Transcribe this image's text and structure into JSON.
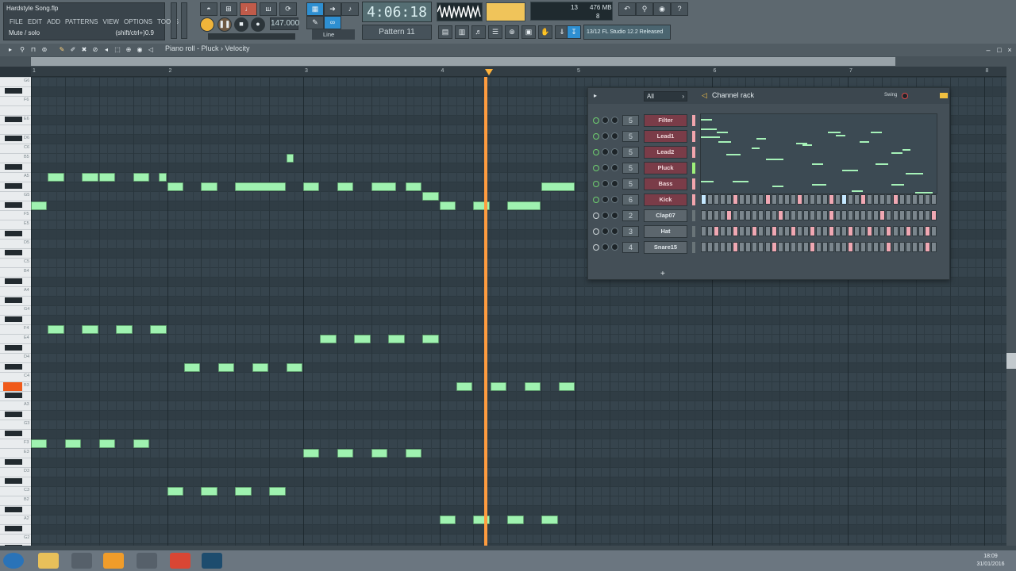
{
  "project": {
    "title": "Hardstyle Song.flp",
    "menus": [
      "FILE",
      "EDIT",
      "ADD",
      "PATTERNS",
      "VIEW",
      "OPTIONS",
      "TOOLS",
      "?"
    ],
    "hint_left": "Mute / solo",
    "hint_right": "(shift/ctrl+)0.9"
  },
  "transport": {
    "time": "4:06:18",
    "tempo": "147.000",
    "pattern": "Pattern 11",
    "snap": "Line",
    "cpu_top": "13",
    "cpu_mem": "476 MB",
    "cpu_bottom": "8",
    "news": "13/12  FL Studio 12.2 Released"
  },
  "piano_roll": {
    "breadcrumb": "Piano roll - Pluck › Velocity",
    "bars": [
      "1",
      "2",
      "3",
      "4",
      "5",
      "6",
      "7",
      "8"
    ],
    "key_labels": [
      {
        "label": "G6",
        "row": 0
      },
      {
        "label": "F6",
        "row": 2
      },
      {
        "label": "E6",
        "row": 4
      },
      {
        "label": "D6",
        "row": 6
      },
      {
        "label": "C6",
        "row": 7
      },
      {
        "label": "B5",
        "row": 8
      },
      {
        "label": "A5",
        "row": 10
      },
      {
        "label": "G5",
        "row": 12
      },
      {
        "label": "F5",
        "row": 14
      },
      {
        "label": "E5",
        "row": 15
      },
      {
        "label": "D5",
        "row": 17
      },
      {
        "label": "C5",
        "row": 19
      },
      {
        "label": "B4",
        "row": 20
      },
      {
        "label": "A4",
        "row": 22
      },
      {
        "label": "G4",
        "row": 24
      },
      {
        "label": "F4",
        "row": 26
      },
      {
        "label": "E4",
        "row": 27
      },
      {
        "label": "D4",
        "row": 29
      },
      {
        "label": "C4",
        "row": 31
      },
      {
        "label": "B3",
        "row": 32
      },
      {
        "label": "A3",
        "row": 34
      },
      {
        "label": "G3",
        "row": 36
      },
      {
        "label": "F3",
        "row": 38
      },
      {
        "label": "E3",
        "row": 39
      },
      {
        "label": "D3",
        "row": 41
      },
      {
        "label": "C3",
        "row": 43
      },
      {
        "label": "B2",
        "row": 44
      },
      {
        "label": "A2",
        "row": 46
      },
      {
        "label": "G2",
        "row": 48
      }
    ],
    "notes": [
      {
        "pitch": "B5",
        "start": 2.875,
        "length": 0.0625
      },
      {
        "pitch": "A5",
        "start": 1.125,
        "length": 0.125
      },
      {
        "pitch": "A5",
        "start": 1.375,
        "length": 0.125
      },
      {
        "pitch": "A5",
        "start": 1.5,
        "length": 0.125
      },
      {
        "pitch": "A5",
        "start": 1.75,
        "length": 0.125
      },
      {
        "pitch": "A5",
        "start": 1.938,
        "length": 0.0625
      },
      {
        "pitch": "G#5",
        "start": 2.0,
        "length": 0.125
      },
      {
        "pitch": "G#5",
        "start": 2.25,
        "length": 0.125
      },
      {
        "pitch": "G#5",
        "start": 2.5,
        "length": 0.375
      },
      {
        "pitch": "G#5",
        "start": 3.0,
        "length": 0.125
      },
      {
        "pitch": "G#5",
        "start": 3.25,
        "length": 0.125
      },
      {
        "pitch": "G#5",
        "start": 3.5,
        "length": 0.188
      },
      {
        "pitch": "G#5",
        "start": 3.75,
        "length": 0.125
      },
      {
        "pitch": "G#5",
        "start": 4.75,
        "length": 0.25
      },
      {
        "pitch": "G5",
        "start": 3.875,
        "length": 0.125
      },
      {
        "pitch": "F#5",
        "start": 1.0,
        "length": 0.125
      },
      {
        "pitch": "F#5",
        "start": 4.0,
        "length": 0.125
      },
      {
        "pitch": "F#5",
        "start": 4.25,
        "length": 0.125
      },
      {
        "pitch": "F#5",
        "start": 4.5,
        "length": 0.25
      },
      {
        "pitch": "F4",
        "start": 1.125,
        "length": 0.125
      },
      {
        "pitch": "F4",
        "start": 1.375,
        "length": 0.125
      },
      {
        "pitch": "F4",
        "start": 1.625,
        "length": 0.125
      },
      {
        "pitch": "F4",
        "start": 1.875,
        "length": 0.125
      },
      {
        "pitch": "E4",
        "start": 3.125,
        "length": 0.125
      },
      {
        "pitch": "E4",
        "start": 3.375,
        "length": 0.125
      },
      {
        "pitch": "E4",
        "start": 3.625,
        "length": 0.125
      },
      {
        "pitch": "E4",
        "start": 3.875,
        "length": 0.125
      },
      {
        "pitch": "C#4",
        "start": 2.125,
        "length": 0.125
      },
      {
        "pitch": "C#4",
        "start": 2.375,
        "length": 0.125
      },
      {
        "pitch": "C#4",
        "start": 2.625,
        "length": 0.125
      },
      {
        "pitch": "C#4",
        "start": 2.875,
        "length": 0.125
      },
      {
        "pitch": "B3",
        "start": 4.125,
        "length": 0.125
      },
      {
        "pitch": "B3",
        "start": 4.375,
        "length": 0.125
      },
      {
        "pitch": "B3",
        "start": 4.625,
        "length": 0.125
      },
      {
        "pitch": "B3",
        "start": 4.875,
        "length": 0.125
      },
      {
        "pitch": "F3",
        "start": 1.0,
        "length": 0.125
      },
      {
        "pitch": "F3",
        "start": 1.25,
        "length": 0.125
      },
      {
        "pitch": "F3",
        "start": 1.5,
        "length": 0.125
      },
      {
        "pitch": "F3",
        "start": 1.75,
        "length": 0.125
      },
      {
        "pitch": "E3",
        "start": 3.0,
        "length": 0.125
      },
      {
        "pitch": "E3",
        "start": 3.25,
        "length": 0.125
      },
      {
        "pitch": "E3",
        "start": 3.5,
        "length": 0.125
      },
      {
        "pitch": "E3",
        "start": 3.75,
        "length": 0.125
      },
      {
        "pitch": "C3",
        "start": 2.0,
        "length": 0.125
      },
      {
        "pitch": "C3",
        "start": 2.25,
        "length": 0.125
      },
      {
        "pitch": "C3",
        "start": 2.5,
        "length": 0.125
      },
      {
        "pitch": "C3",
        "start": 2.75,
        "length": 0.125
      },
      {
        "pitch": "A2",
        "start": 4.0,
        "length": 0.125
      },
      {
        "pitch": "A2",
        "start": 4.25,
        "length": 0.125
      },
      {
        "pitch": "A2",
        "start": 4.5,
        "length": 0.125
      },
      {
        "pitch": "A2",
        "start": 4.75,
        "length": 0.125
      }
    ],
    "playhead_bar": 4.34,
    "highlighted_key": "B3"
  },
  "channel_rack": {
    "title": "Channel rack",
    "filter": "All",
    "swing_label": "Swing",
    "add_label": "+",
    "channels": [
      {
        "name": "Filter",
        "number": "5",
        "style": "red",
        "sel": "pink",
        "led_on": true
      },
      {
        "name": "Lead1",
        "number": "5",
        "style": "red",
        "sel": "pink",
        "led_on": true
      },
      {
        "name": "Lead2",
        "number": "5",
        "style": "red",
        "sel": "pink",
        "led_on": true
      },
      {
        "name": "Pluck",
        "number": "5",
        "style": "red",
        "sel": "green",
        "led_on": true
      },
      {
        "name": "Bass",
        "number": "5",
        "style": "red",
        "sel": "pink",
        "led_on": true
      },
      {
        "name": "Kick",
        "number": "6",
        "style": "red",
        "sel": "pink",
        "led_on": true,
        "steps": [
          1,
          0,
          0,
          0,
          0,
          1,
          0,
          0,
          0,
          0,
          1,
          0,
          0,
          0,
          0,
          1,
          0,
          0,
          0,
          0,
          1,
          0,
          0,
          0,
          0,
          1,
          0,
          0,
          0,
          0,
          1,
          0,
          0,
          0,
          0,
          0,
          0,
          0,
          0,
          0,
          1,
          0,
          0,
          0,
          0,
          0,
          0,
          0
        ]
      },
      {
        "name": "Clap07",
        "number": "2",
        "style": "grey",
        "sel": "grey",
        "led_on": false,
        "steps": [
          0,
          0,
          0,
          0,
          1,
          0,
          0,
          0,
          0,
          0,
          0,
          0,
          1,
          0,
          0,
          0,
          0,
          0,
          0,
          0,
          1,
          0,
          0,
          0,
          0,
          0,
          0,
          0,
          1,
          0,
          0,
          0,
          0,
          0,
          0,
          0,
          1,
          0,
          0,
          0,
          0,
          0,
          0,
          0,
          1,
          0,
          0,
          0
        ]
      },
      {
        "name": "Hat",
        "number": "3",
        "style": "grey",
        "sel": "grey",
        "led_on": false,
        "steps": [
          0,
          0,
          1,
          0,
          0,
          1,
          0,
          0,
          1,
          0,
          0,
          1,
          0,
          0,
          1,
          0,
          0,
          1,
          0,
          0,
          1,
          0,
          0,
          1,
          0,
          0,
          1,
          0,
          0,
          1,
          0,
          0,
          1,
          0,
          0,
          1,
          0,
          0,
          1,
          0,
          0,
          1,
          0,
          0,
          1,
          0,
          0,
          0
        ]
      },
      {
        "name": "Snare15",
        "number": "4",
        "style": "grey",
        "sel": "grey",
        "led_on": false,
        "steps": [
          0,
          0,
          0,
          0,
          0,
          1,
          0,
          0,
          0,
          0,
          0,
          1,
          0,
          0,
          0,
          0,
          0,
          1,
          0,
          0,
          0,
          0,
          0,
          1,
          0,
          0,
          0,
          0,
          0,
          1,
          0,
          0,
          0,
          0,
          0,
          1,
          0,
          0,
          0,
          0,
          0,
          1,
          0,
          0,
          0,
          0,
          0,
          0
        ]
      }
    ]
  },
  "taskbar": {
    "time": "18:09",
    "date": "31/01/2016"
  }
}
